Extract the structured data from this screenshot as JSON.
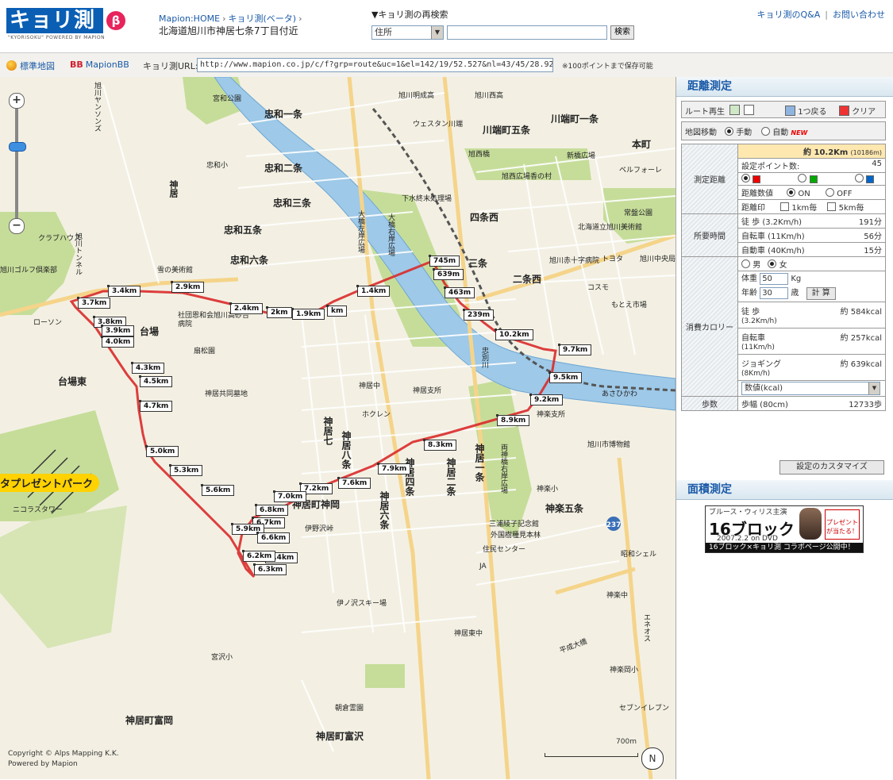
{
  "header": {
    "logo_text": "キョリ測",
    "logo_beta": "β",
    "logo_sub": "\"KYORISOKU\" POWERED BY MAPION",
    "breadcrumb": [
      "Mapion:HOME",
      "キョリ測(ベータ)"
    ],
    "location": "北海道旭川市神居七条7丁目付近",
    "research_title": "▼キョリ測の再検索",
    "search_select": "住所",
    "search_value": "",
    "search_button": "検索",
    "links": [
      "キョリ測のQ&A",
      "お問い合わせ"
    ]
  },
  "toolbar": {
    "std_map": "標準地図",
    "mapion_bb": "MapionBB",
    "url_label": "キョリ測URL:",
    "url_value": "http://www.mapion.co.jp/c/f?grp=route&uc=1&el=142/19/52.527&nl=43/45/28.928&scl=",
    "url_note": "※100ポイントまで保存可能"
  },
  "map": {
    "distance_labels": [
      "3.4km",
      "2.9km",
      "3.7km",
      "2.4km",
      "2km",
      "1.9km",
      "km",
      "1.4km",
      "745m",
      "639m",
      "463m",
      "239m",
      "3.8km",
      "3.9km",
      "4.0km",
      "10.2km",
      "9.7km",
      "9.5km",
      "4.3km",
      "4.5km",
      "4.7km",
      "9.2km",
      "8.9km",
      "8.3km",
      "7.9km",
      "7.6km",
      "7.2km",
      "7.0km",
      "5.0km",
      "5.3km",
      "5.6km",
      "6.8km",
      "6.7km",
      "5.9km",
      "6.6km",
      "6.4km",
      "6.2km",
      "6.3km"
    ],
    "district_labels": [
      "忠和一条",
      "忠和二条",
      "忠和三条",
      "忠和五条",
      "忠和六条",
      "台場",
      "台場東",
      "川端町五条",
      "川端町一条",
      "本町",
      "四条西",
      "三条",
      "二条西",
      "神楽五条",
      "神居町神岡",
      "神居町富岡",
      "神居町富沢"
    ],
    "vertical_labels": [
      "神居七",
      "神居八条",
      "神居四条",
      "神居二条",
      "神居一条",
      "神居六条",
      "神居"
    ],
    "small_labels": [
      "旭川明成高",
      "旭川西高",
      "ウェスタン川端",
      "旭西橋",
      "旭西広場香の村",
      "新橋広場",
      "ベルフォーレ",
      "常盤公園",
      "北海道立旭川美術館",
      "旭川赤十字病院",
      "トヨタ",
      "旭川中央局",
      "コスモ",
      "もとえ市場",
      "あさひかわ",
      "旭川市博物館",
      "神楽支所",
      "ホクレン",
      "神居支所",
      "神居中",
      "神居東中",
      "住民センター",
      "JA",
      "外国樹種見本林",
      "三浦綾子記念館",
      "神楽小",
      "神楽中",
      "昭和シェル",
      "神楽岡小",
      "セブンイレブン",
      "伊ノ沢スキー場",
      "朝倉霊園",
      "宮沢小",
      "伊野沢峠",
      "神居共同墓地",
      "社団恩和会旭川高砂台病院",
      "扇松園",
      "ローソン",
      "クラブハウス",
      "雪の美術館",
      "忠和小",
      "下水終末処理場",
      "宮和公園",
      "旭川ゴルフ倶楽部",
      "ニコラスタワー",
      "忠別川",
      "大橋左岸広場",
      "大橋右岸広場",
      "両神橋右岸広場",
      "平成大橋",
      "エネオス",
      "旭川トンネル",
      "旭川ヤンソンズ"
    ],
    "park_label": "タプレゼントパーク",
    "copyright": [
      "Copyright © Alps Mapping K.K.",
      "Powered by Mapion"
    ],
    "scale": "700m",
    "route_number": "237",
    "zoom_plus": "+",
    "zoom_minus": "−",
    "compass": "N"
  },
  "panel": {
    "distance_title": "距離測定",
    "route_replay": "ルート再生",
    "back_one": "1つ戻る",
    "clear": "クリア",
    "map_move": "地図移動",
    "manual": "手動",
    "auto": "自動",
    "new_badge": "NEW",
    "total_distance": "約 10.2Km",
    "total_distance_m": "(10186m)",
    "section_measured": "測定距離",
    "setting_points_label": "設定ポイント数:",
    "setting_points": "45",
    "distance_value_label": "距離数値",
    "on": "ON",
    "off": "OFF",
    "distance_mark_label": "距離印",
    "mark_1km": "1km毎",
    "mark_5km": "5km毎",
    "section_time": "所要時間",
    "times": [
      {
        "label": "徒 歩 (3.2Km/h)",
        "value": "191分"
      },
      {
        "label": "自転車 (11Km/h)",
        "value": "56分"
      },
      {
        "label": "自動車 (40Km/h)",
        "value": "15分"
      }
    ],
    "section_calorie": "消費カロリー",
    "male": "男",
    "female": "女",
    "weight_label": "体重",
    "weight": "50",
    "weight_unit": "Kg",
    "age_label": "年齢",
    "age": "30",
    "age_unit": "歳",
    "calc_button": "計 算",
    "calories": [
      {
        "label": "徒 歩",
        "sub": "(3.2Km/h)",
        "value": "約 584kcal"
      },
      {
        "label": "自転車",
        "sub": "(11Km/h)",
        "value": "約 257kcal"
      },
      {
        "label": "ジョギング",
        "sub": "(8Km/h)",
        "value": "約 639kcal"
      }
    ],
    "kcal_select": "数値(kcal)",
    "section_steps": "歩数",
    "steps_label": "歩幅 (80cm)",
    "steps_value": "12733歩",
    "customize_button": "設定のカスタマイズ",
    "area_title": "面積測定",
    "ad": {
      "top": "ブルース・ウィリス主演",
      "title": "16ブロック",
      "date": "2007.2.2 on DVD",
      "present": "プレゼントが当たる！",
      "bar": "16ブロック×キョリ測 コラボページ公開中！"
    }
  }
}
